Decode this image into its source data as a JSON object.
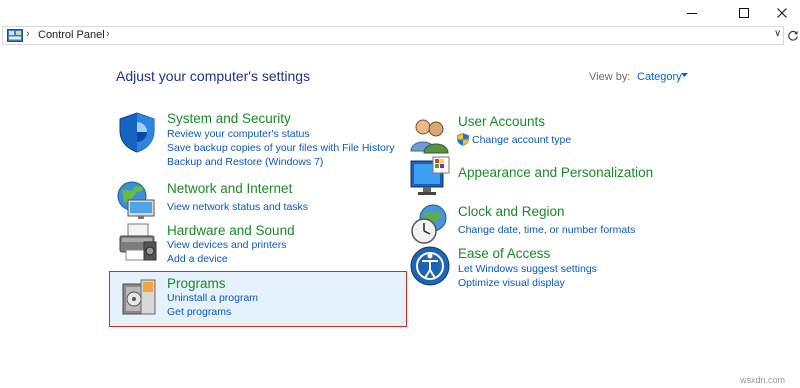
{
  "titlebar": {
    "minimize_icon": "minimize-icon",
    "maximize_icon": "maximize-icon",
    "close_icon": "close-icon"
  },
  "address": {
    "breadcrumb": [
      "Control Panel"
    ],
    "dropdown_glyph": "∨",
    "refresh_icon": "refresh-icon"
  },
  "main": {
    "title": "Adjust your computer's settings",
    "view_by": {
      "label": "View by:",
      "value": "Category"
    }
  },
  "categories": {
    "system": {
      "title": "System and Security",
      "links": [
        "Review your computer's status",
        "Save backup copies of your files with File History",
        "Backup and Restore (Windows 7)"
      ]
    },
    "network": {
      "title": "Network and Internet",
      "links": [
        "View network status and tasks"
      ]
    },
    "hardware": {
      "title": "Hardware and Sound",
      "links": [
        "View devices and printers",
        "Add a device"
      ]
    },
    "programs": {
      "title": "Programs",
      "links": [
        "Uninstall a program",
        "Get programs"
      ]
    },
    "user": {
      "title": "User Accounts",
      "links": [
        "Change account type"
      ]
    },
    "appearance": {
      "title": "Appearance and Personalization",
      "links": []
    },
    "clock": {
      "title": "Clock and Region",
      "links": [
        "Change date, time, or number formats"
      ]
    },
    "ease": {
      "title": "Ease of Access",
      "links": [
        "Let Windows suggest settings",
        "Optimize visual display"
      ]
    }
  },
  "colors": {
    "category_title": "#1a8a26",
    "link": "#0a58b8",
    "heading": "#1e3287",
    "highlight_border": "#e0262a",
    "highlight_bg": "#e5f2fb"
  },
  "watermark": "wsxdn.com"
}
